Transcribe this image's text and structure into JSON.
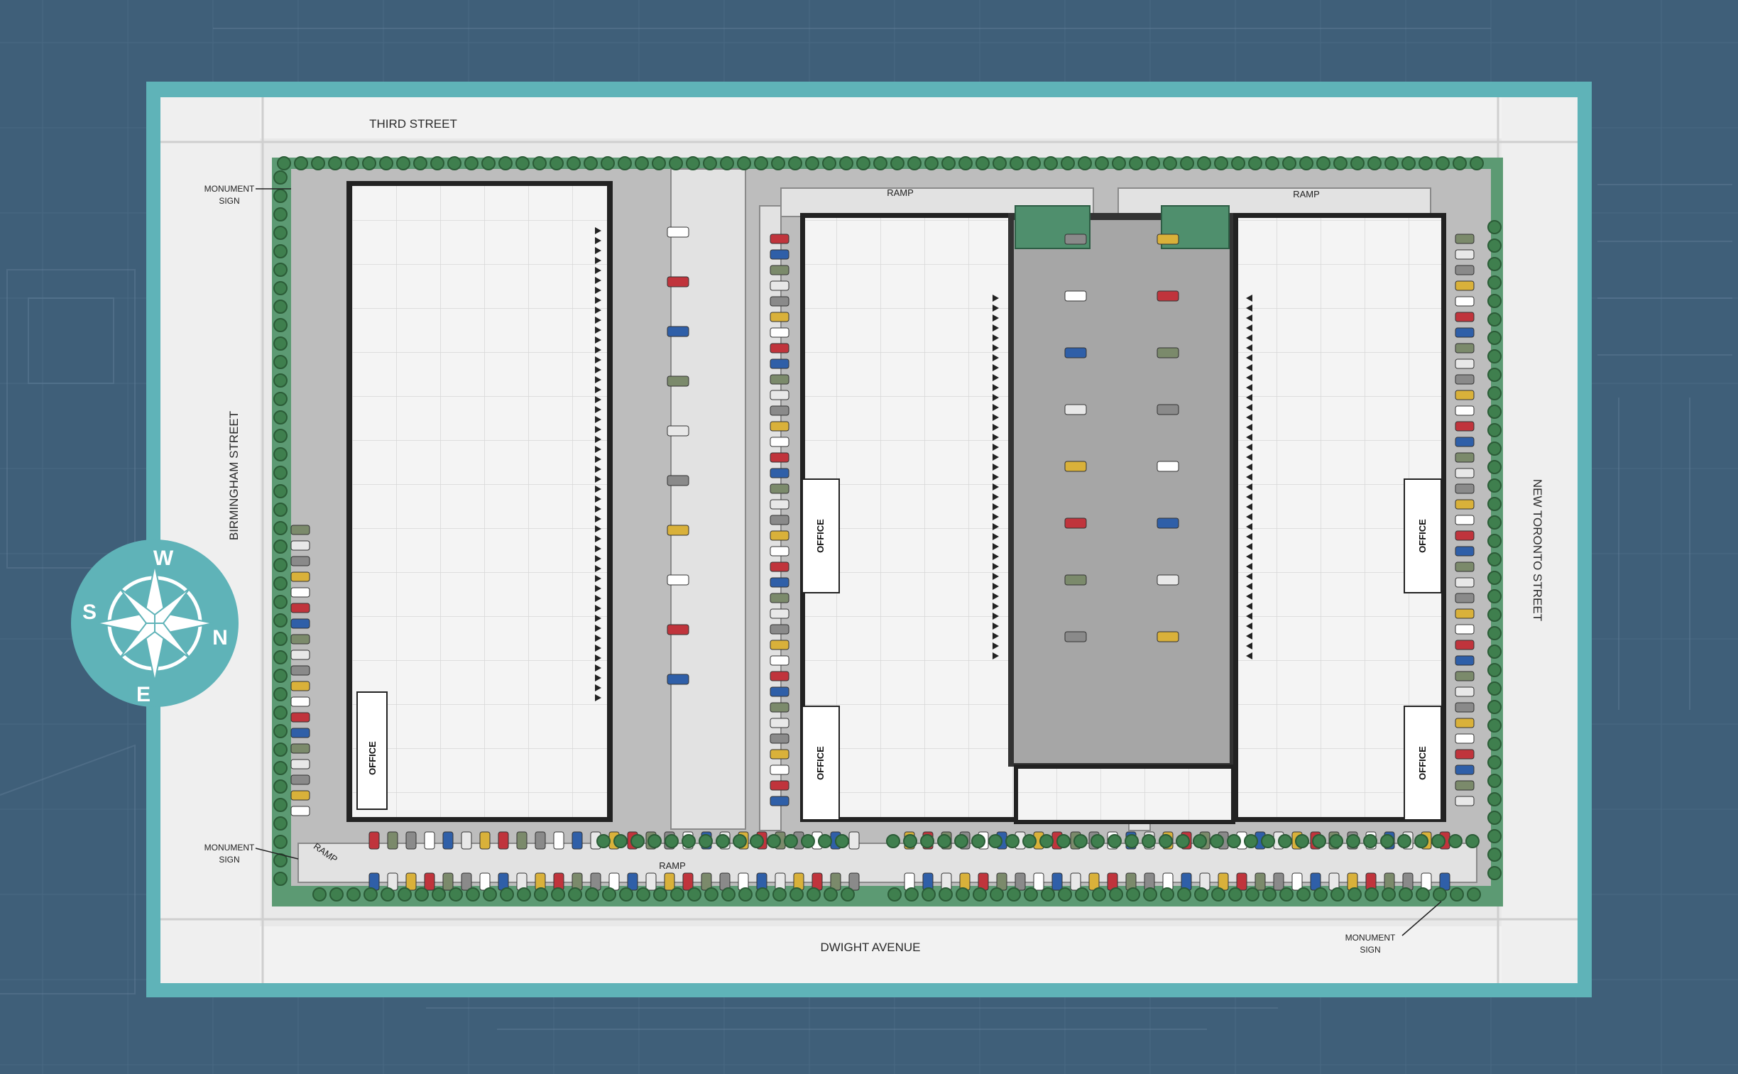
{
  "colors": {
    "background": "#3f5f79",
    "frame": "#5fb3b8",
    "landscape": "#5c9a73",
    "building": "#f3f3f3",
    "paving": "#bdbdbd",
    "road": "#e8e8e8",
    "accent_red": "#c0343c",
    "accent_blue": "#2f5fa8"
  },
  "streets": {
    "north": "THIRD STREET",
    "south": "DWIGHT AVENUE",
    "west": "BIRMINGHAM STREET",
    "east": "NEW TORONTO STREET"
  },
  "ramps": [
    "RAMP",
    "RAMP",
    "RAMP",
    "RAMP"
  ],
  "offices": [
    "OFFICE",
    "OFFICE",
    "OFFICE",
    "OFFICE",
    "OFFICE"
  ],
  "signs": {
    "nw": [
      "MONUMENT",
      "SIGN"
    ],
    "sw": [
      "MONUMENT",
      "SIGN"
    ],
    "se": [
      "MONUMENT",
      "SIGN"
    ]
  },
  "compass": {
    "top": "W",
    "right": "N",
    "bottom": "E",
    "left": "S"
  }
}
